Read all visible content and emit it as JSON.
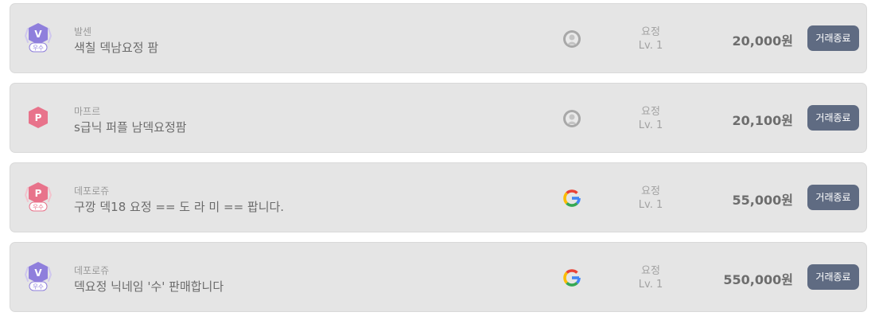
{
  "listings": [
    {
      "grade_letter": "V",
      "grade_badge": "우수",
      "grade_color": "#8f7fdc",
      "grade_icon": "v-grade-badge-icon",
      "seller": "발센",
      "title": "색칠 덱남요정 팜",
      "login_type": "default-avatar-icon",
      "category": "요정",
      "level": "Lv. 1",
      "price": "20,000원",
      "status_label": "거래종료"
    },
    {
      "grade_letter": "P",
      "grade_badge": "",
      "grade_color": "#e8738b",
      "grade_icon": "p-grade-badge-icon",
      "seller": "마프르",
      "title": "s급닉 퍼플 남덱요정팜",
      "login_type": "default-avatar-icon",
      "category": "요정",
      "level": "Lv. 1",
      "price": "20,100원",
      "status_label": "거래종료"
    },
    {
      "grade_letter": "P",
      "grade_badge": "우수",
      "grade_color": "#e8738b",
      "grade_icon": "p-grade-badge-icon",
      "seller": "데포로쥬",
      "title": "구깡 덱18 요정 == 도 라 미 == 팝니다.",
      "login_type": "google-icon",
      "category": "요정",
      "level": "Lv. 1",
      "price": "55,000원",
      "status_label": "거래종료"
    },
    {
      "grade_letter": "V",
      "grade_badge": "우수",
      "grade_color": "#8f7fdc",
      "grade_icon": "v-grade-badge-icon",
      "seller": "데포로쥬",
      "title": "덱요정 닉네임 '수' 판매합니다",
      "login_type": "google-icon",
      "category": "요정",
      "level": "Lv. 1",
      "price": "550,000원",
      "status_label": "거래종료"
    }
  ]
}
